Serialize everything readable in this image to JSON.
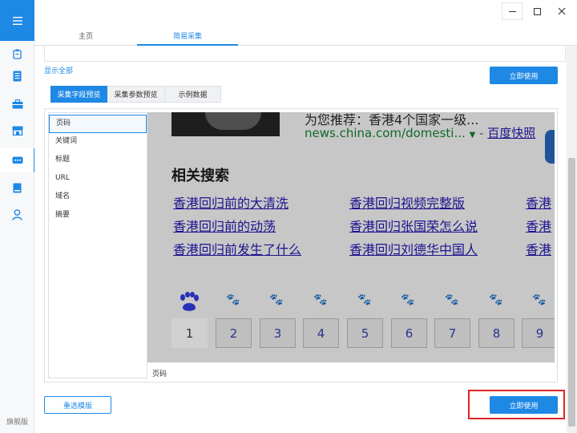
{
  "sidebar": {
    "menu_icon": "hamburger-icon",
    "items": [
      {
        "icon": "clipboard-icon"
      },
      {
        "icon": "document-icon"
      },
      {
        "icon": "briefcase-icon"
      },
      {
        "icon": "store-icon"
      },
      {
        "icon": "chat-icon",
        "active": true
      },
      {
        "icon": "book-icon"
      },
      {
        "icon": "user-icon"
      }
    ],
    "edition_label": "旗舰版"
  },
  "nav": {
    "tabs": [
      {
        "label": "主页",
        "active": false
      },
      {
        "label": "简易采集",
        "active": true
      }
    ]
  },
  "window_controls": {
    "minimize": "—",
    "maximize": "☐",
    "close": "✕"
  },
  "content": {
    "show_all_label": "显示全部",
    "use_now_label": "立即使用",
    "sub_tabs": [
      {
        "label": "采集字段预览",
        "active": true
      },
      {
        "label": "采集参数预览",
        "active": false
      },
      {
        "label": "示例数据",
        "active": false
      }
    ],
    "fields": [
      "页码",
      "关键词",
      "标题",
      "URL",
      "域名",
      "摘要"
    ],
    "preview": {
      "cut_text": "为您推荐：香港4个国家一级...",
      "source_url": "news.china.com/domesti...",
      "source_arrow": "▼",
      "source_dash": "-",
      "source_snapshot": "百度快照",
      "related_title": "相关搜索",
      "related_links": [
        "香港回归前的大清洗",
        "香港回归视频完整版",
        "香港",
        "香港回归前的动荡",
        "香港回归张国荣怎么说",
        "香港",
        "香港回归前发生了什么",
        "香港回归刘德华中国人",
        "香港"
      ],
      "pages": [
        "1",
        "2",
        "3",
        "4",
        "5",
        "6",
        "7",
        "8",
        "9"
      ],
      "current_page": "1"
    },
    "preview_caption": "页码",
    "reselect_label": "重选模版",
    "accent_color": "#1e88e5",
    "highlight_color": "#e02424"
  }
}
